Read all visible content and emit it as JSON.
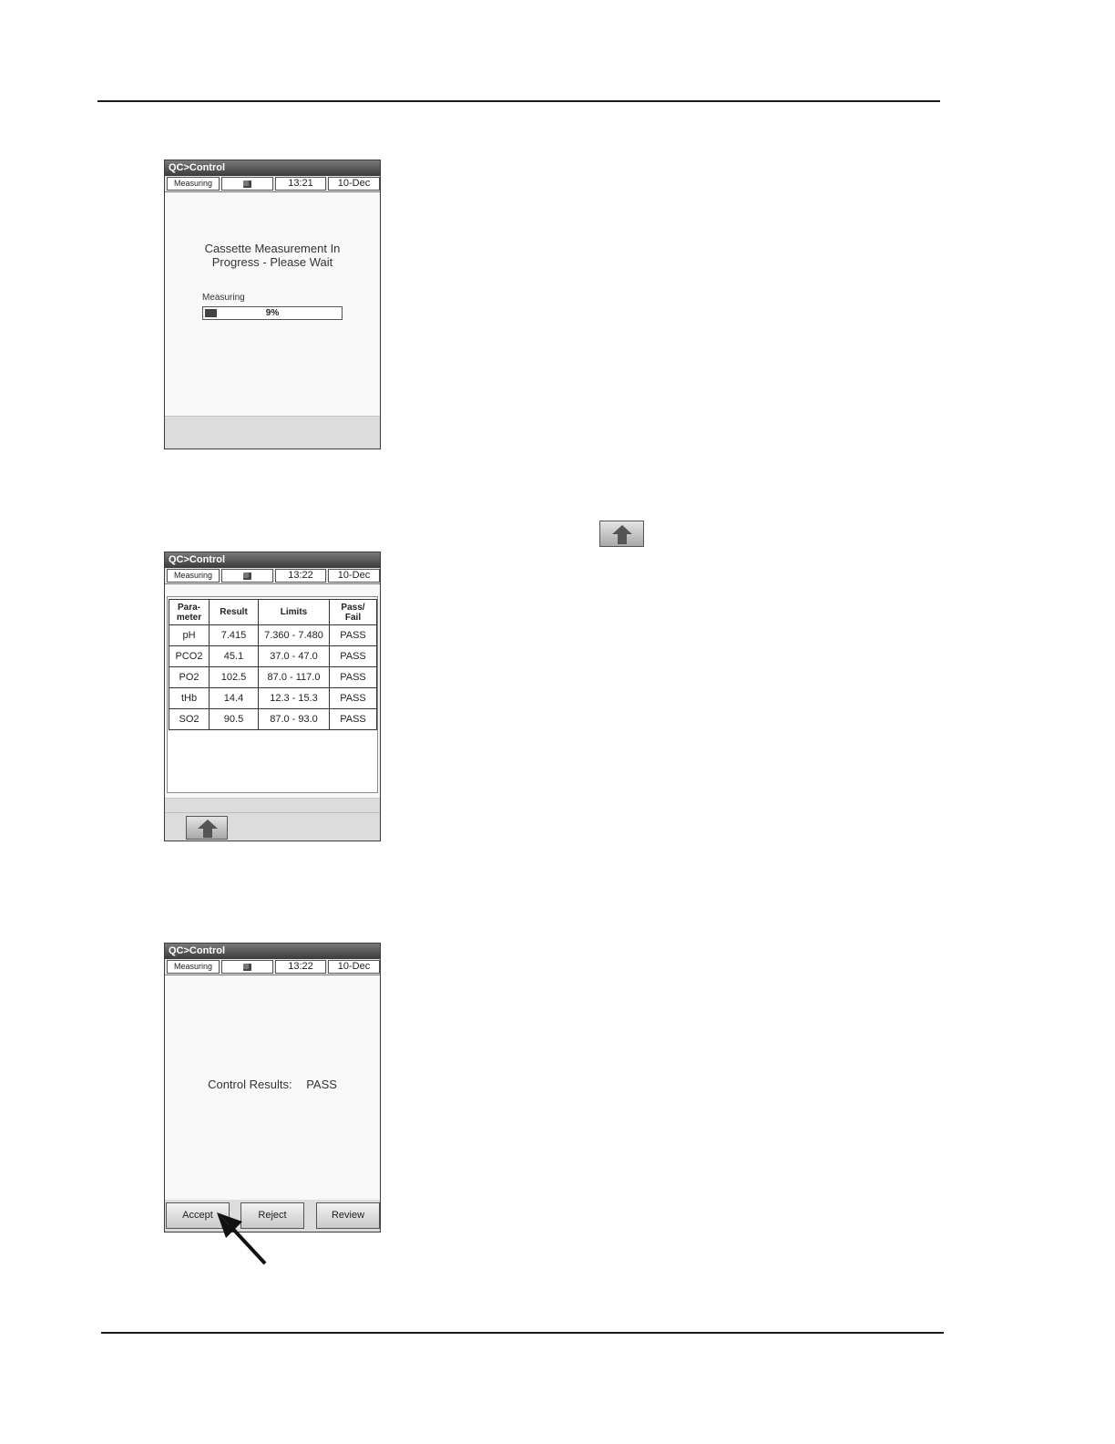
{
  "screen_title": "QC>Control",
  "screens": [
    {
      "status": {
        "mode": "Measuring",
        "time": "13:21",
        "date": "10-Dec"
      },
      "message_line1": "Cassette Measurement In",
      "message_line2": "Progress - Please Wait",
      "progress_label": "Measuring",
      "progress_percent": 9,
      "progress_text": "9%"
    },
    {
      "status": {
        "mode": "Measuring",
        "time": "13:22",
        "date": "10-Dec"
      },
      "table": {
        "headers": {
          "parameter_1": "Para-",
          "parameter_2": "meter",
          "result": "Result",
          "limits": "Limits",
          "passfail_1": "Pass/",
          "passfail_2": "Fail"
        },
        "rows": [
          {
            "parameter": "pH",
            "result": "7.415",
            "limits": "7.360 - 7.480",
            "status": "PASS"
          },
          {
            "parameter": "PCO2",
            "result": "45.1",
            "limits": "37.0 - 47.0",
            "status": "PASS"
          },
          {
            "parameter": "PO2",
            "result": "102.5",
            "limits": "87.0 - 117.0",
            "status": "PASS"
          },
          {
            "parameter": "tHb",
            "result": "14.4",
            "limits": "12.3 - 15.3",
            "status": "PASS"
          },
          {
            "parameter": "SO2",
            "result": "90.5",
            "limits": "87.0 - 93.0",
            "status": "PASS"
          }
        ]
      }
    },
    {
      "status": {
        "mode": "Measuring",
        "time": "13:22",
        "date": "10-Dec"
      },
      "result_label": "Control Results:",
      "result_value": "PASS",
      "buttons": {
        "accept": "Accept",
        "reject": "Reject",
        "review": "Review"
      }
    }
  ],
  "icons": {
    "cassette": "cassette-icon",
    "up_arrow": "up-arrow-icon",
    "pointer": "pointer-arrow-icon"
  },
  "colors": {
    "title_bar": "#3a3a3a",
    "pass_text": "#c8c8c8"
  }
}
